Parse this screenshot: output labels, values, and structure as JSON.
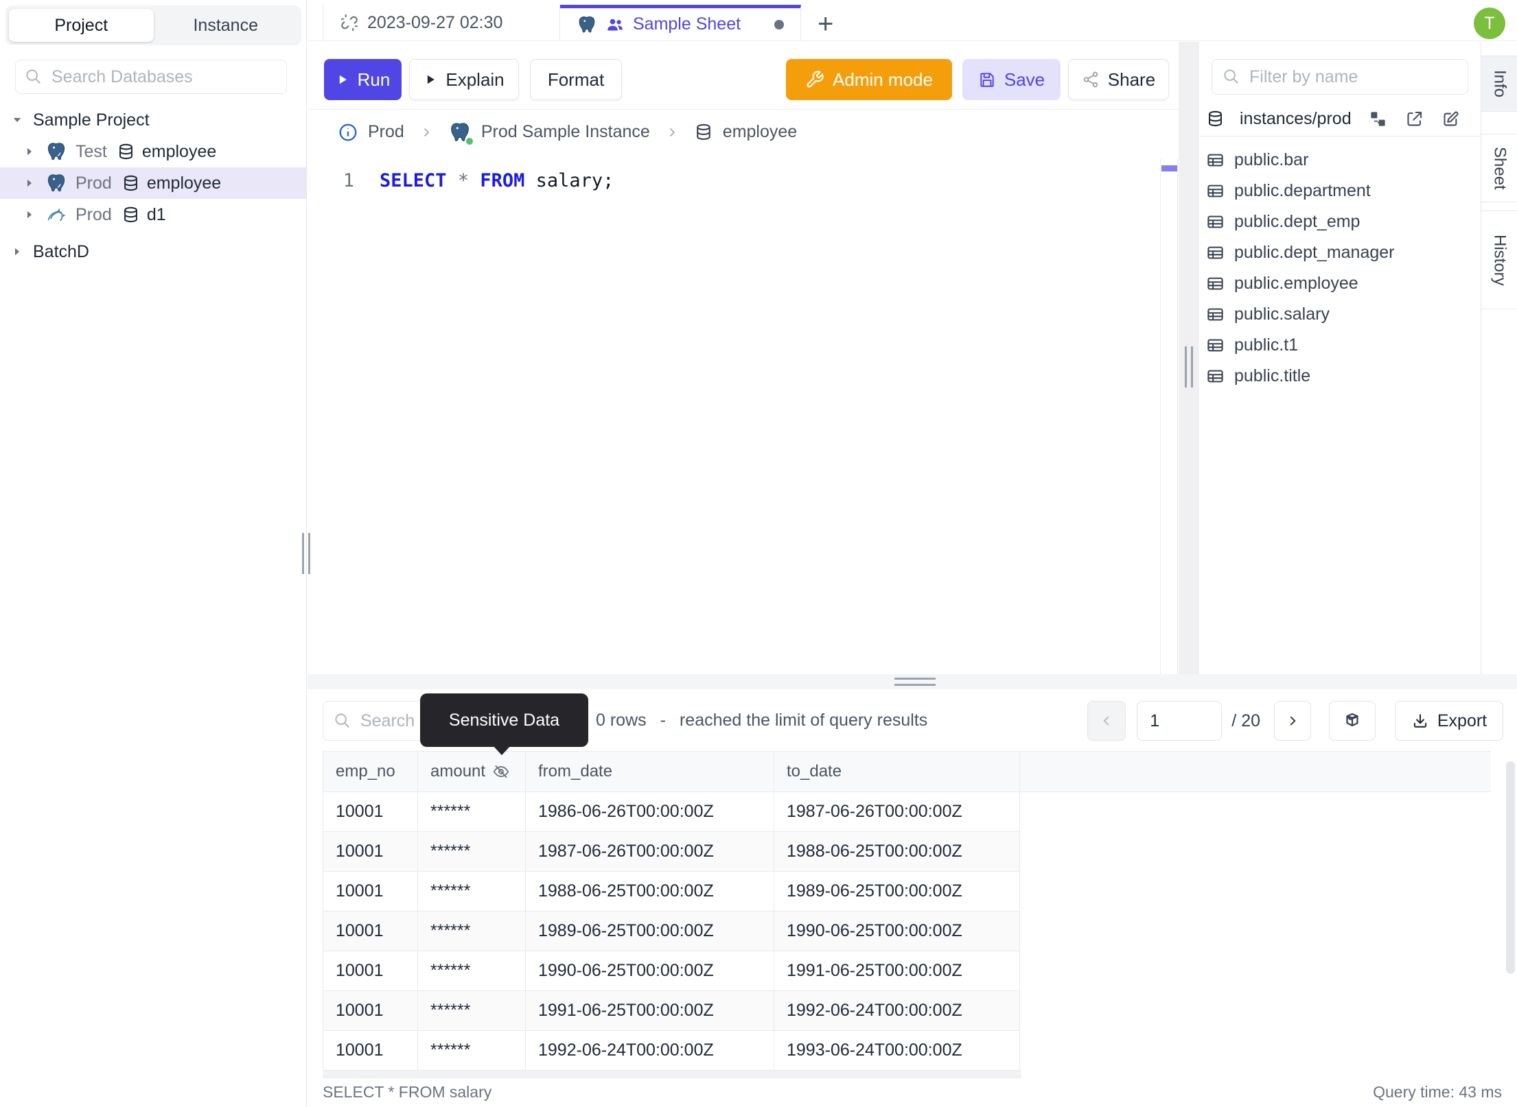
{
  "left_sidebar": {
    "tabs": {
      "project": "Project",
      "instance": "Instance"
    },
    "search_placeholder": "Search Databases",
    "tree": {
      "project1": "Sample Project",
      "nodes": [
        {
          "env": "Test",
          "db": "employee",
          "engine": "postgresql"
        },
        {
          "env": "Prod",
          "db": "employee",
          "engine": "postgresql",
          "selected": true
        },
        {
          "env": "Prod",
          "db": "d1",
          "engine": "mysql"
        }
      ],
      "project2": "BatchD"
    }
  },
  "tab_bar": {
    "tab1_label": "2023-09-27 02:30",
    "tab2_label": "Sample Sheet",
    "new_tab_label": "+"
  },
  "avatar": {
    "initial": "T"
  },
  "toolbar": {
    "run": "Run",
    "explain": "Explain",
    "format": "Format",
    "admin_mode": "Admin mode",
    "save": "Save",
    "share": "Share"
  },
  "breadcrumb": {
    "environment": "Prod",
    "instance": "Prod Sample Instance",
    "database": "employee"
  },
  "editor": {
    "line_number": "1",
    "sql": {
      "kw1": "SELECT",
      "star": "*",
      "kw2": "FROM",
      "rest": "salary;"
    }
  },
  "right_sidebar": {
    "filter_placeholder": "Filter by name",
    "connection": "instances/prod",
    "tables": [
      "public.bar",
      "public.department",
      "public.dept_emp",
      "public.dept_manager",
      "public.employee",
      "public.salary",
      "public.t1",
      "public.title"
    ],
    "side_tabs": {
      "info": "Info",
      "sheet": "Sheet",
      "history": "History"
    }
  },
  "results": {
    "search_placeholder": "Search",
    "tooltip": "Sensitive Data",
    "rows_count": "0 rows",
    "separator": "-",
    "limit_message": "reached the limit of query results",
    "pagination": {
      "page": "1",
      "total": "/ 20"
    },
    "export_label": "Export",
    "grid": {
      "columns": [
        {
          "name": "emp_no",
          "masked": false
        },
        {
          "name": "amount",
          "masked": true
        },
        {
          "name": "from_date",
          "masked": false
        },
        {
          "name": "to_date",
          "masked": false
        }
      ],
      "rows": [
        [
          "10001",
          "******",
          "1986-06-26T00:00:00Z",
          "1987-06-26T00:00:00Z"
        ],
        [
          "10001",
          "******",
          "1987-06-26T00:00:00Z",
          "1988-06-25T00:00:00Z"
        ],
        [
          "10001",
          "******",
          "1988-06-25T00:00:00Z",
          "1989-06-25T00:00:00Z"
        ],
        [
          "10001",
          "******",
          "1989-06-25T00:00:00Z",
          "1990-06-25T00:00:00Z"
        ],
        [
          "10001",
          "******",
          "1990-06-25T00:00:00Z",
          "1991-06-25T00:00:00Z"
        ],
        [
          "10001",
          "******",
          "1991-06-25T00:00:00Z",
          "1992-06-24T00:00:00Z"
        ],
        [
          "10001",
          "******",
          "1992-06-24T00:00:00Z",
          "1993-06-24T00:00:00Z"
        ]
      ]
    },
    "status_sql": "SELECT * FROM salary",
    "status_time": "Query time: 43 ms"
  },
  "colors": {
    "accent": "#4F46E5",
    "admin_orange": "#F59E0B",
    "avatar_green": "#7CBF3F",
    "keyword_blue": "#1C1CE0",
    "selected_row": "#E9E7F8",
    "tooltip_bg": "#26262A",
    "status_green": "#4CC764"
  }
}
